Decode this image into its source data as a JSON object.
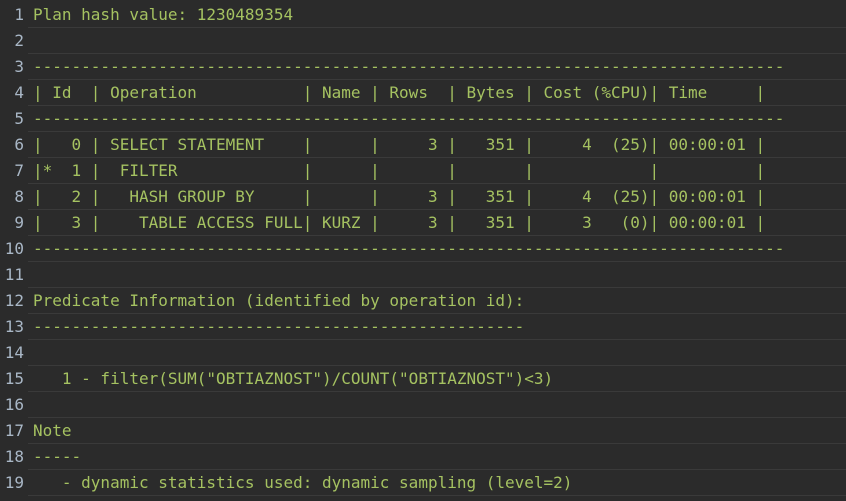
{
  "editor": {
    "line_numbers": [
      "1",
      "2",
      "3",
      "4",
      "5",
      "6",
      "7",
      "8",
      "9",
      "10",
      "11",
      "12",
      "13",
      "14",
      "15",
      "16",
      "17",
      "18",
      "19"
    ],
    "lines": [
      "Plan hash value: 1230489354",
      "",
      "------------------------------------------------------------------------------",
      "| Id  | Operation           | Name | Rows  | Bytes | Cost (%CPU)| Time     |",
      "------------------------------------------------------------------------------",
      "|   0 | SELECT STATEMENT    |      |     3 |   351 |     4  (25)| 00:00:01 |",
      "|*  1 |  FILTER             |      |       |       |            |          |",
      "|   2 |   HASH GROUP BY     |      |     3 |   351 |     4  (25)| 00:00:01 |",
      "|   3 |    TABLE ACCESS FULL| KURZ |     3 |   351 |     3   (0)| 00:00:01 |",
      "------------------------------------------------------------------------------",
      "",
      "Predicate Information (identified by operation id):",
      "---------------------------------------------------",
      "",
      "   1 - filter(SUM(\"OBTIAZNOST\")/COUNT(\"OBTIAZNOST\")<3)",
      "",
      "Note",
      "-----",
      "   - dynamic statistics used: dynamic sampling (level=2)"
    ]
  },
  "colors": {
    "background": "#2b2b2b",
    "text": "#a5c261",
    "line_number": "#a9b7c6",
    "separator": "#3a3a3a"
  }
}
